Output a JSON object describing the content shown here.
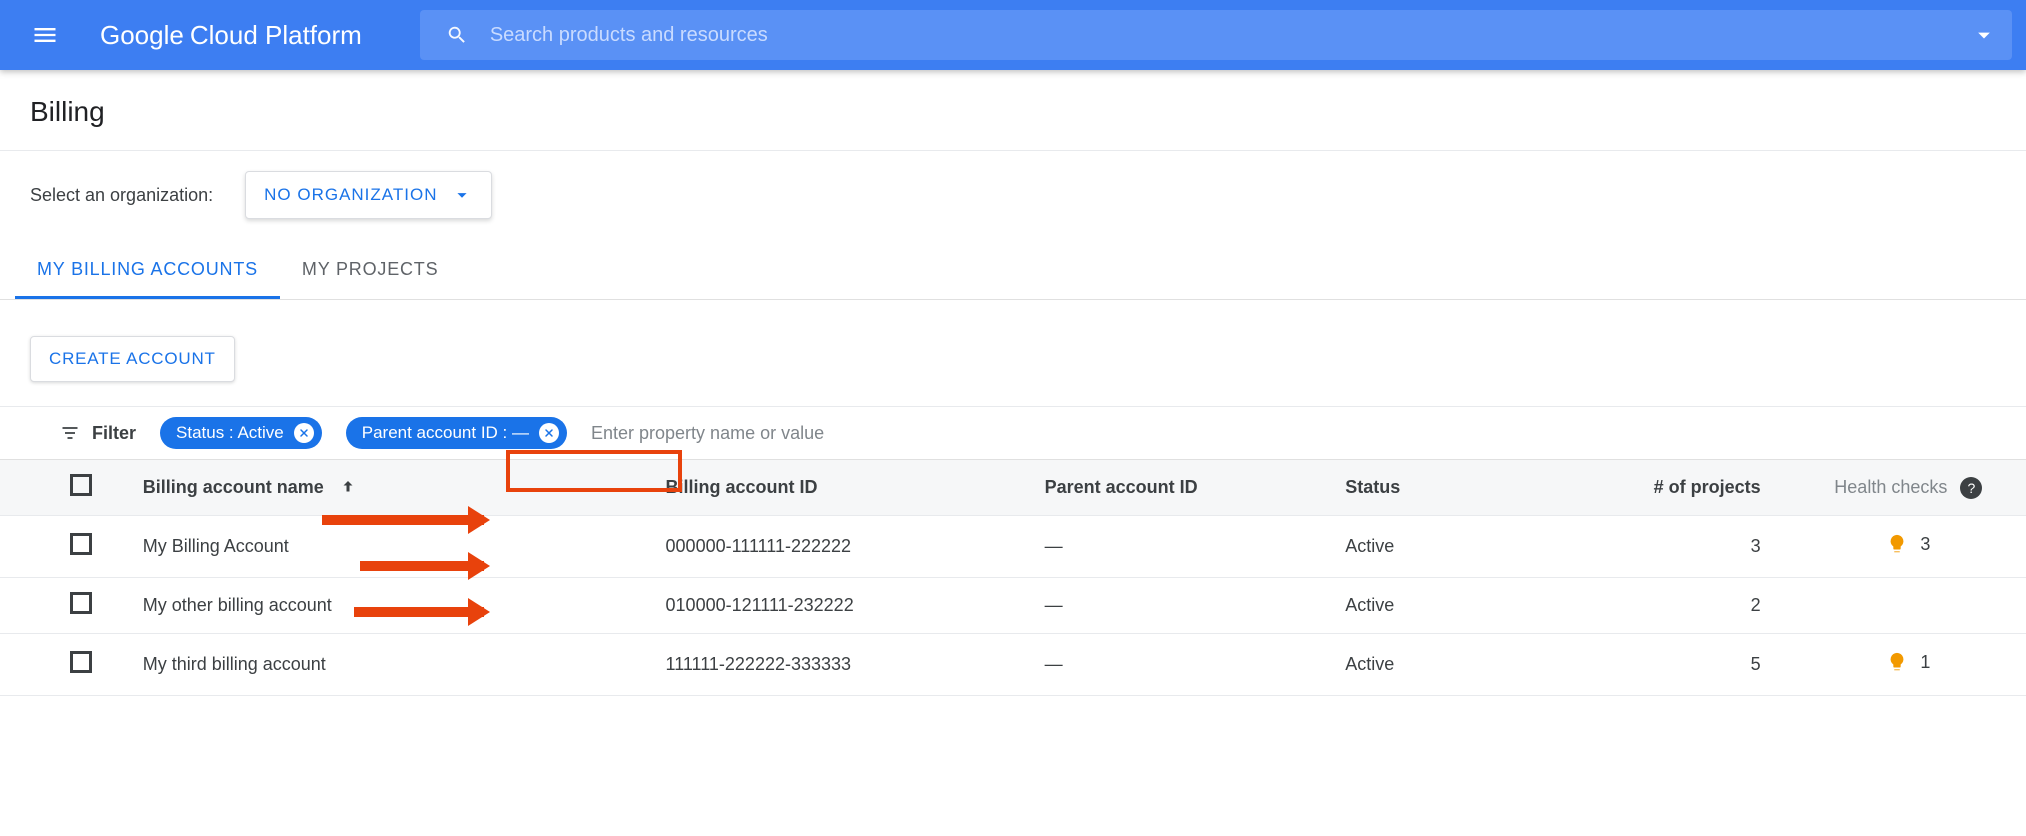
{
  "header": {
    "logo_google": "Google",
    "logo_rest": "Cloud Platform",
    "search_placeholder": "Search products and resources"
  },
  "page": {
    "title": "Billing",
    "org_label": "Select an organization:",
    "org_selected": "NO ORGANIZATION"
  },
  "tabs": {
    "billing": "MY BILLING ACCOUNTS",
    "projects": "MY PROJECTS"
  },
  "actions": {
    "create": "CREATE ACCOUNT"
  },
  "filter": {
    "label": "Filter",
    "chip_status": "Status : Active",
    "chip_parent": "Parent account ID : —",
    "placeholder": "Enter property name or value"
  },
  "table": {
    "cols": {
      "name": "Billing account name",
      "id": "Billing account ID",
      "parent": "Parent account ID",
      "status": "Status",
      "projects": "# of projects",
      "health": "Health checks"
    },
    "rows": [
      {
        "name": "My Billing Account",
        "id": "000000-111111-222222",
        "parent": "—",
        "status": "Active",
        "projects": "3",
        "health": "3"
      },
      {
        "name": "My other billing account",
        "id": "010000-121111-232222",
        "parent": "—",
        "status": "Active",
        "projects": "2",
        "health": ""
      },
      {
        "name": "My third billing account",
        "id": "111111-222222-333333",
        "parent": "—",
        "status": "Active",
        "projects": "5",
        "health": "1"
      }
    ]
  }
}
